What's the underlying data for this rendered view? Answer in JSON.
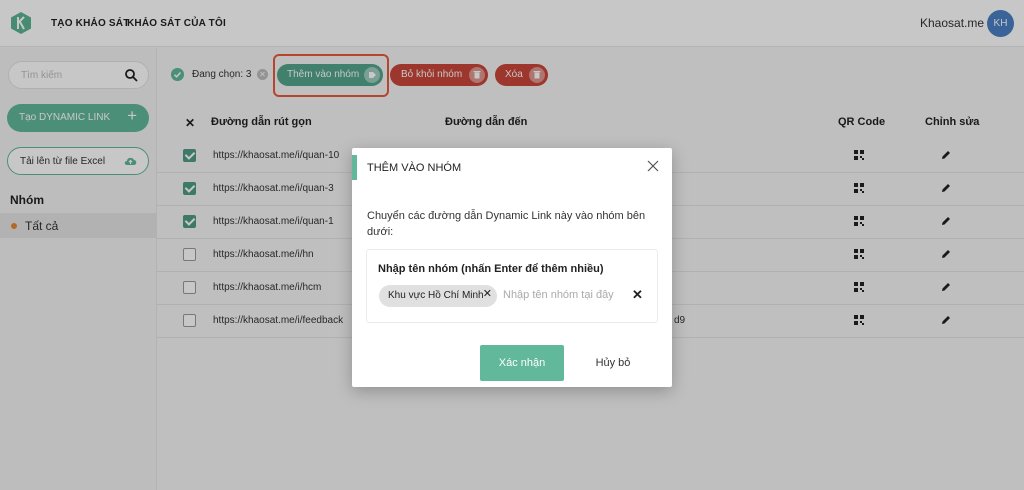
{
  "header": {
    "nav": [
      "TẠO KHẢO SÁT",
      "KHẢO SÁT CỦA TÔI"
    ],
    "brand": "Khaosat.me",
    "avatar_initials": "KH"
  },
  "sidebar": {
    "search_placeholder": "Tìm kiếm",
    "create_dynamic_label": "Tạo DYNAMIC LINK",
    "upload_excel_label": "Tải lên từ file Excel",
    "group_heading": "Nhóm",
    "groups": [
      {
        "label": "Tất cả",
        "dot_color": "#e58a32"
      }
    ]
  },
  "toolbar": {
    "selected_label": "Đang chọn: 3",
    "add_to_group": "Thêm vào nhóm",
    "remove_from_group": "Bỏ khỏi nhóm",
    "delete": "Xóa"
  },
  "table": {
    "headers": {
      "select": "✕",
      "short_link": "Đường dẫn rút gọn",
      "target": "Đường dẫn đến",
      "qr": "QR Code",
      "edit": "Chỉnh sửa"
    },
    "rows": [
      {
        "checked": true,
        "url": "https://khaosat.me/i/quan-10"
      },
      {
        "checked": true,
        "url": "https://khaosat.me/i/quan-3"
      },
      {
        "checked": true,
        "url": "https://khaosat.me/i/quan-1"
      },
      {
        "checked": false,
        "url": "https://khaosat.me/i/hn"
      },
      {
        "checked": false,
        "url": "https://khaosat.me/i/hcm"
      },
      {
        "checked": false,
        "url": "https://khaosat.me/i/feedback"
      }
    ],
    "partial_text_row6": "d9"
  },
  "modal": {
    "title": "THÊM VÀO NHÓM",
    "description": "Chuyển các đường dẫn Dynamic Link này vào nhóm bên dưới:",
    "input_label": "Nhập tên nhóm (nhấn Enter để thêm nhiều)",
    "tag": "Khu vực Hồ Chí Minh",
    "placeholder": "Nhập tên nhóm tại đây",
    "confirm": "Xác nhận",
    "cancel": "Hủy bỏ"
  },
  "colors": {
    "accent": "#62b89a",
    "danger": "#c9463a",
    "highlight": "#e8593d",
    "avatar": "#4a7fc4"
  },
  "icons": [
    "app-logo-icon",
    "search-icon",
    "plus-icon",
    "cloud-upload-icon",
    "check-circle-icon",
    "clear-icon",
    "tag-icon",
    "trash-icon",
    "qr-icon",
    "pencil-icon",
    "close-icon"
  ]
}
